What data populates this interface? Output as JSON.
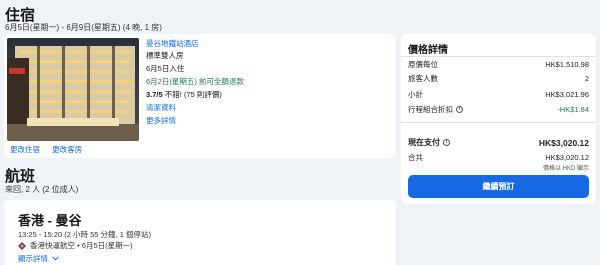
{
  "stay": {
    "title": "住宿",
    "dates": "6月5日(星期一) - 6月9日(星期五) (4 晚, 1 房)",
    "hotel": {
      "name": "曼谷地鐵站酒店",
      "room_type": "標準雙人房",
      "checkin": "6月5日入住",
      "cancellation": "6月2日(星期五) 前可全額退款",
      "rating_score": "3.7/5",
      "rating_word": "不錯!",
      "reviews": "(75 則評價)",
      "policy_link": "清潔資料",
      "more_link": "更多詳情"
    },
    "change_stay": "更改住宿",
    "change_room": "更改客房"
  },
  "flight": {
    "title": "航班",
    "subtitle": "來回, 2 人 (2 位成人)",
    "route": "香港 - 曼谷",
    "time": "13:25 - 15:20 (2 小時 55 分鐘, 1 個停站)",
    "airline": "香港快運航空 • 6月5日(星期一)",
    "details": "顯示詳情"
  },
  "price": {
    "title": "價格詳情",
    "rows": [
      {
        "label": "原價每位",
        "value": "HK$1,510.98"
      },
      {
        "label": "旅客人數",
        "value": "2"
      },
      {
        "label": "小計",
        "value": "HK$3,021.96"
      },
      {
        "label": "行程組合折扣",
        "value": "-HK$1.84"
      }
    ],
    "pay_now_label": "現在支付",
    "pay_now_value": "HK$3,020.12",
    "total_label": "合共",
    "total_value": "HK$3,020.12",
    "currency_note": "價格以 HKD 顯示",
    "checkout": "繼續預訂"
  },
  "colors": {
    "accent": "#1668e3",
    "discount": "#227950",
    "background": "#eff3f8"
  },
  "icons": [
    "info-icon",
    "airline-logo-icon",
    "chevron-down-icon"
  ]
}
